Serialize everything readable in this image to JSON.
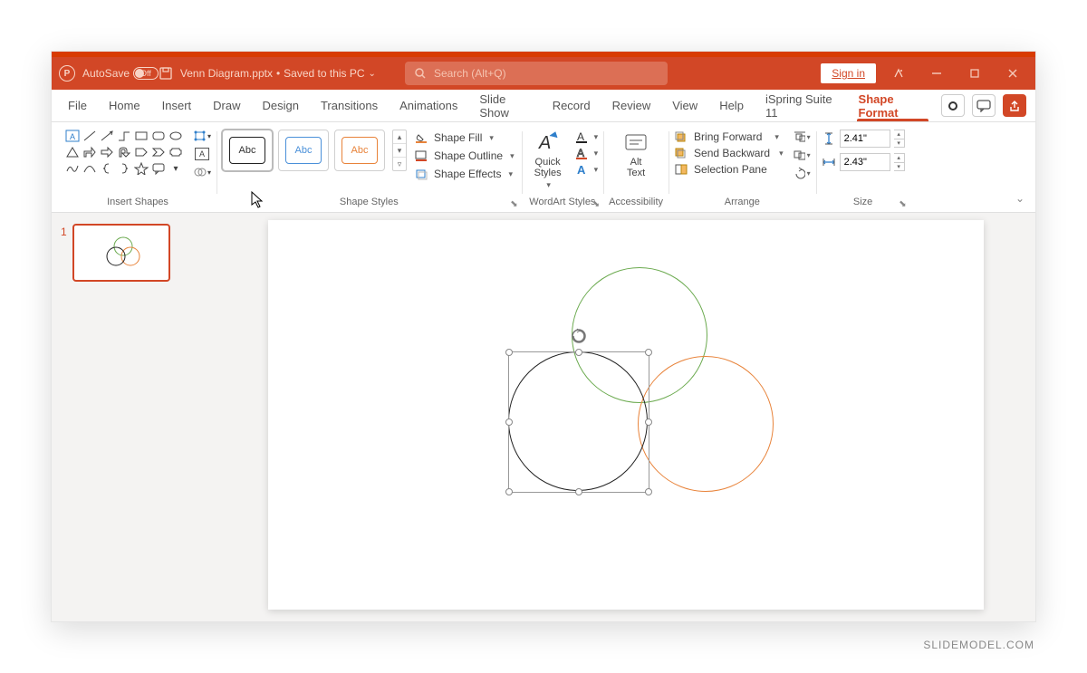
{
  "titlebar": {
    "autosave_label": "AutoSave",
    "autosave_state": "Off",
    "filename": "Venn Diagram.pptx",
    "save_status": "Saved to this PC",
    "search_placeholder": "Search (Alt+Q)",
    "signin_label": "Sign in"
  },
  "tabs": {
    "items": [
      "File",
      "Home",
      "Insert",
      "Draw",
      "Design",
      "Transitions",
      "Animations",
      "Slide Show",
      "Record",
      "Review",
      "View",
      "Help",
      "iSpring Suite 11",
      "Shape Format"
    ],
    "active": "Shape Format"
  },
  "ribbon": {
    "groups": {
      "insert_shapes": "Insert Shapes",
      "shape_styles": "Shape Styles",
      "wordart_styles": "WordArt Styles",
      "accessibility": "Accessibility",
      "arrange": "Arrange",
      "size": "Size"
    },
    "shape_style_sample": "Abc",
    "shape_fill": "Shape Fill",
    "shape_outline": "Shape Outline",
    "shape_effects": "Shape Effects",
    "quick_styles": "Quick\nStyles",
    "alt_text": "Alt\nText",
    "bring_forward": "Bring Forward",
    "send_backward": "Send Backward",
    "selection_pane": "Selection Pane",
    "size_height": "2.41\"",
    "size_width": "2.43\""
  },
  "thumbs": {
    "num": "1"
  },
  "colors": {
    "green": "#6BAA4F",
    "orange": "#E8833A",
    "black": "#222222"
  },
  "watermark": "SLIDEMODEL.COM"
}
